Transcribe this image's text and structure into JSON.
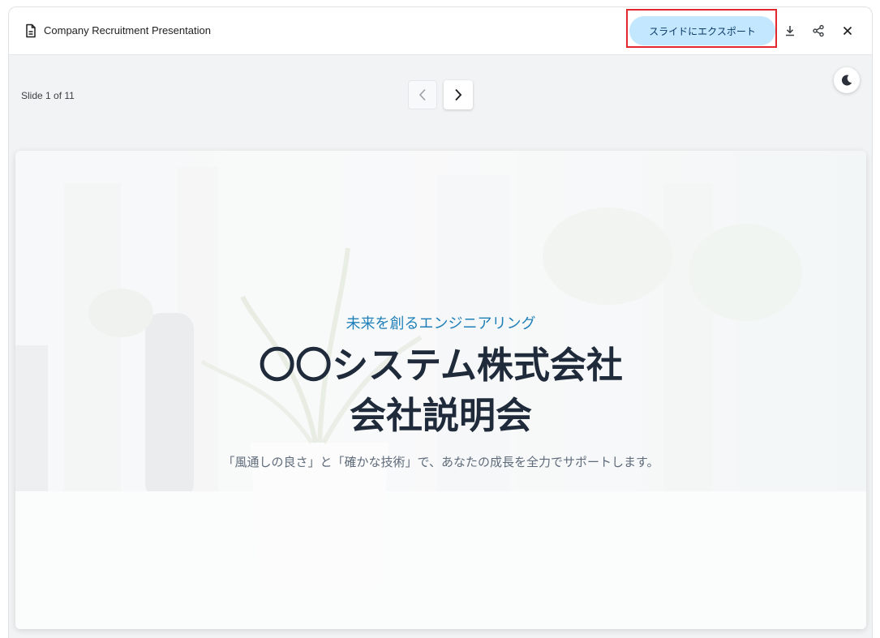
{
  "header": {
    "title": "Company Recruitment Presentation",
    "export_label": "スライドにエクスポート",
    "icons": [
      "document-icon",
      "download-icon",
      "share-icon",
      "close-icon"
    ]
  },
  "viewer": {
    "slide_counter": "Slide 1 of 11",
    "current_slide": 1,
    "total_slides": 11
  },
  "slide": {
    "subtitle": "未来を創るエンジニアリング",
    "title_line1": "〇〇システム株式会社",
    "title_line2": "会社説明会",
    "tagline": "「風通しの良さ」と「確かな技術」で、あなたの成長を全力でサポートします。"
  },
  "colors": {
    "export_button": "#c2e7ff",
    "highlight_border": "#e0282e",
    "subtitle": "#1f7fb8",
    "title": "#1f2a3a"
  }
}
